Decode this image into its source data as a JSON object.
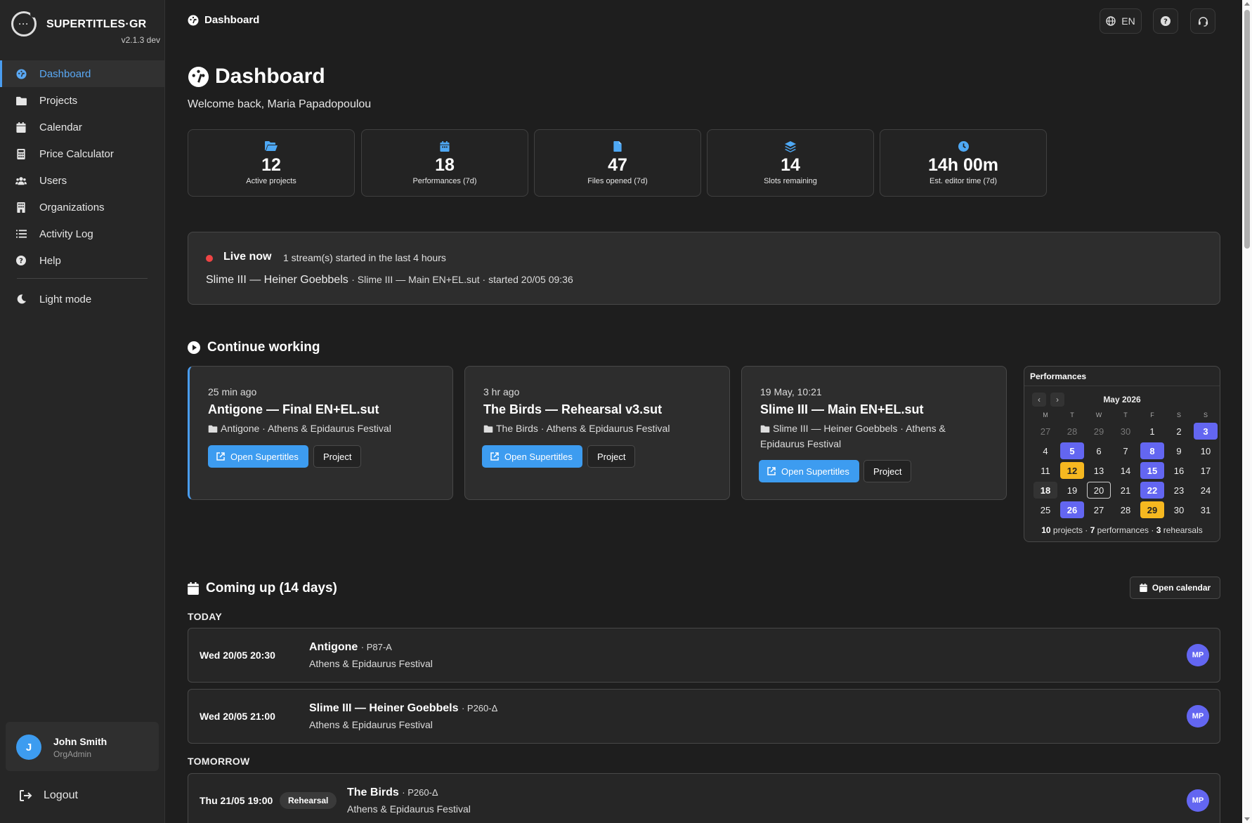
{
  "brand": {
    "name": "SUPERTITLES·GR",
    "version": "v2.1.3 dev",
    "logo_text": "···"
  },
  "sidebar": {
    "items": [
      {
        "label": "Dashboard",
        "icon": "dashboard-icon",
        "active": true
      },
      {
        "label": "Projects",
        "icon": "folder-icon"
      },
      {
        "label": "Calendar",
        "icon": "calendar-icon"
      },
      {
        "label": "Price Calculator",
        "icon": "calculator-icon"
      },
      {
        "label": "Users",
        "icon": "users-icon"
      },
      {
        "label": "Organizations",
        "icon": "building-icon"
      },
      {
        "label": "Activity Log",
        "icon": "list-icon"
      },
      {
        "label": "Help",
        "icon": "help-icon"
      }
    ],
    "theme_toggle": "Light mode",
    "user": {
      "initial": "J",
      "name": "John Smith",
      "role": "OrgAdmin"
    },
    "logout": "Logout"
  },
  "topbar": {
    "title": "Dashboard",
    "language": "EN"
  },
  "page": {
    "title": "Dashboard",
    "welcome": "Welcome back, Maria Papadopoulou"
  },
  "stats": [
    {
      "value": "12",
      "label": "Active projects",
      "icon": "folder-open-icon"
    },
    {
      "value": "18",
      "label": "Performances (7d)",
      "icon": "calendar-icon"
    },
    {
      "value": "47",
      "label": "Files opened (7d)",
      "icon": "file-icon"
    },
    {
      "value": "14",
      "label": "Slots remaining",
      "icon": "layers-icon"
    },
    {
      "value": "14h 00m",
      "label": "Est. editor time (7d)",
      "icon": "clock-icon"
    }
  ],
  "live": {
    "label": "Live now",
    "subtitle": "1 stream(s) started in the last 4 hours",
    "stream_title": "Slime III — Heiner Goebbels",
    "stream_detail": "· Slime III — Main EN+EL.sut · started 20/05 09:36"
  },
  "continue": {
    "title": "Continue working",
    "open_label": "Open Supertitles",
    "project_label": "Project",
    "cards": [
      {
        "time": "25 min ago",
        "title": "Antigone — Final EN+EL.sut",
        "meta": "Antigone · Athens & Epidaurus Festival"
      },
      {
        "time": "3 hr ago",
        "title": "The Birds — Rehearsal v3.sut",
        "meta": "The Birds · Athens & Epidaurus Festival"
      },
      {
        "time": "19 May, 10:21",
        "title": "Slime III — Main EN+EL.sut",
        "meta": "Slime III — Heiner Goebbels · Athens & Epidaurus Festival"
      }
    ]
  },
  "calendar": {
    "title": "Performances",
    "month": "May 2026",
    "prev": "‹",
    "next": "›",
    "dow": [
      "M",
      "T",
      "W",
      "T",
      "F",
      "S",
      "S"
    ],
    "days": [
      {
        "d": "27",
        "t": "muted"
      },
      {
        "d": "28",
        "t": "muted"
      },
      {
        "d": "29",
        "t": "muted"
      },
      {
        "d": "30",
        "t": "muted"
      },
      {
        "d": "1",
        "t": ""
      },
      {
        "d": "2",
        "t": ""
      },
      {
        "d": "3",
        "t": "perf"
      },
      {
        "d": "4",
        "t": ""
      },
      {
        "d": "5",
        "t": "perf"
      },
      {
        "d": "6",
        "t": ""
      },
      {
        "d": "7",
        "t": ""
      },
      {
        "d": "8",
        "t": "perf"
      },
      {
        "d": "9",
        "t": ""
      },
      {
        "d": "10",
        "t": ""
      },
      {
        "d": "11",
        "t": ""
      },
      {
        "d": "12",
        "t": "reh"
      },
      {
        "d": "13",
        "t": ""
      },
      {
        "d": "14",
        "t": ""
      },
      {
        "d": "15",
        "t": "perf"
      },
      {
        "d": "16",
        "t": ""
      },
      {
        "d": "17",
        "t": ""
      },
      {
        "d": "18",
        "t": "sel"
      },
      {
        "d": "19",
        "t": ""
      },
      {
        "d": "20",
        "t": "today"
      },
      {
        "d": "21",
        "t": ""
      },
      {
        "d": "22",
        "t": "perf"
      },
      {
        "d": "23",
        "t": ""
      },
      {
        "d": "24",
        "t": ""
      },
      {
        "d": "25",
        "t": ""
      },
      {
        "d": "26",
        "t": "perf"
      },
      {
        "d": "27",
        "t": ""
      },
      {
        "d": "28",
        "t": ""
      },
      {
        "d": "29",
        "t": "reh"
      },
      {
        "d": "30",
        "t": ""
      },
      {
        "d": "31",
        "t": ""
      }
    ],
    "footer": {
      "projects": "10",
      "projects_label": "projects ·",
      "performances": "7",
      "performances_label": "performances ·",
      "rehearsals": "3",
      "rehearsals_label": "rehearsals"
    },
    "colors": {
      "performance": "#6366f1",
      "rehearsal": "#f6b820"
    }
  },
  "upcoming": {
    "title": "Coming up (14 days)",
    "open_calendar": "Open calendar",
    "today_label": "TODAY",
    "tomorrow_label": "TOMORROW",
    "events": [
      {
        "date": "Wed 20/05 20:30",
        "title": "Antigone",
        "code": "· P87-A",
        "org": "Athens & Epidaurus Festival",
        "avatar": "MP",
        "badge": ""
      },
      {
        "date": "Wed 20/05 21:00",
        "title": "Slime III — Heiner Goebbels",
        "code": "· P260-Δ",
        "org": "Athens & Epidaurus Festival",
        "avatar": "MP",
        "badge": ""
      },
      {
        "date": "Thu 21/05 19:00",
        "title": "The Birds",
        "code": "· P260-Δ",
        "org": "Athens & Epidaurus Festival",
        "avatar": "MP",
        "badge": "Rehearsal"
      }
    ]
  },
  "accent": "#3d9cf0"
}
